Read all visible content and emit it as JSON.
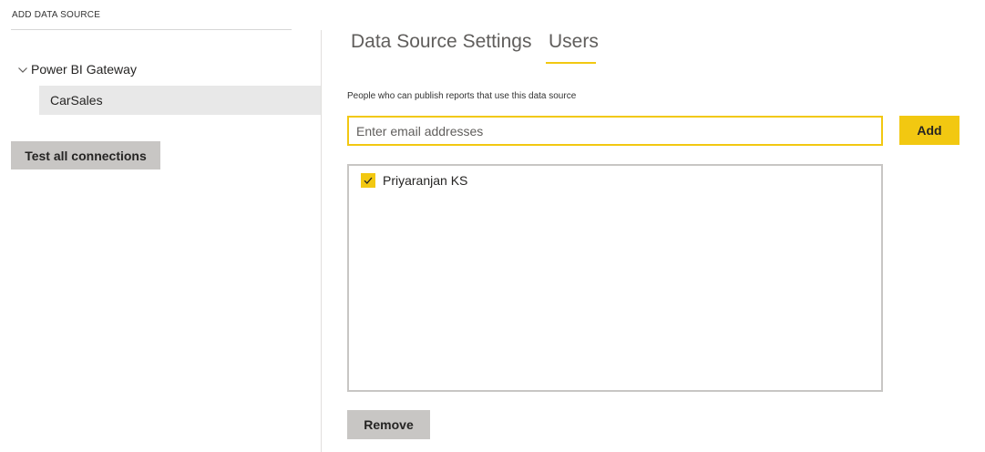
{
  "left_panel": {
    "section_header": "ADD DATA SOURCE",
    "tree": {
      "gateway": {
        "label": "Power BI Gateway",
        "icon": "chevron-down-icon",
        "expanded": true
      },
      "datasource": {
        "label": "CarSales",
        "selected": true
      }
    },
    "test_button_label": "Test all connections"
  },
  "tabs": [
    {
      "label": "Data Source Settings",
      "active": false
    },
    {
      "label": "Users",
      "active": true
    }
  ],
  "users_tab": {
    "description": "People who can publish reports that use this data source",
    "email_input": {
      "placeholder": "Enter email addresses",
      "value": ""
    },
    "add_button_label": "Add",
    "users": [
      {
        "name": "Priyaranjan KS",
        "checked": true
      }
    ],
    "remove_button_label": "Remove"
  },
  "colors": {
    "accent": "#f2c811",
    "button_gray": "#c8c6c4",
    "selection_bg": "#e8e8e8",
    "text": "#252423"
  }
}
